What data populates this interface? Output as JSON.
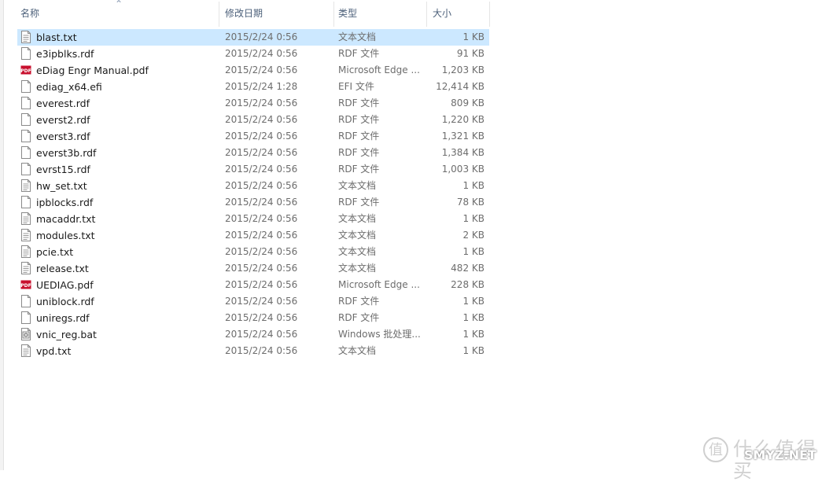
{
  "columns": {
    "name": "名称",
    "modified": "修改日期",
    "type": "类型",
    "size": "大小"
  },
  "files": [
    {
      "name": "blast.txt",
      "date": "2015/2/24 0:56",
      "type": "文本文档",
      "size": "1 KB",
      "icon": "text-file-icon"
    },
    {
      "name": "e3ipblks.rdf",
      "date": "2015/2/24 0:56",
      "type": "RDF 文件",
      "size": "91 KB",
      "icon": "generic-file-icon"
    },
    {
      "name": "eDiag Engr Manual.pdf",
      "date": "2015/2/24 0:56",
      "type": "Microsoft Edge ...",
      "size": "1,203 KB",
      "icon": "pdf-file-icon"
    },
    {
      "name": "ediag_x64.efi",
      "date": "2015/2/24 1:28",
      "type": "EFI 文件",
      "size": "12,414 KB",
      "icon": "generic-file-icon"
    },
    {
      "name": "everest.rdf",
      "date": "2015/2/24 0:56",
      "type": "RDF 文件",
      "size": "809 KB",
      "icon": "generic-file-icon"
    },
    {
      "name": "everst2.rdf",
      "date": "2015/2/24 0:56",
      "type": "RDF 文件",
      "size": "1,220 KB",
      "icon": "generic-file-icon"
    },
    {
      "name": "everst3.rdf",
      "date": "2015/2/24 0:56",
      "type": "RDF 文件",
      "size": "1,321 KB",
      "icon": "generic-file-icon"
    },
    {
      "name": "everst3b.rdf",
      "date": "2015/2/24 0:56",
      "type": "RDF 文件",
      "size": "1,384 KB",
      "icon": "generic-file-icon"
    },
    {
      "name": "evrst15.rdf",
      "date": "2015/2/24 0:56",
      "type": "RDF 文件",
      "size": "1,003 KB",
      "icon": "generic-file-icon"
    },
    {
      "name": "hw_set.txt",
      "date": "2015/2/24 0:56",
      "type": "文本文档",
      "size": "1 KB",
      "icon": "text-file-icon"
    },
    {
      "name": "ipblocks.rdf",
      "date": "2015/2/24 0:56",
      "type": "RDF 文件",
      "size": "78 KB",
      "icon": "generic-file-icon"
    },
    {
      "name": "macaddr.txt",
      "date": "2015/2/24 0:56",
      "type": "文本文档",
      "size": "1 KB",
      "icon": "text-file-icon"
    },
    {
      "name": "modules.txt",
      "date": "2015/2/24 0:56",
      "type": "文本文档",
      "size": "2 KB",
      "icon": "text-file-icon"
    },
    {
      "name": "pcie.txt",
      "date": "2015/2/24 0:56",
      "type": "文本文档",
      "size": "1 KB",
      "icon": "text-file-icon"
    },
    {
      "name": "release.txt",
      "date": "2015/2/24 0:56",
      "type": "文本文档",
      "size": "482 KB",
      "icon": "text-file-icon"
    },
    {
      "name": "UEDIAG.pdf",
      "date": "2015/2/24 0:56",
      "type": "Microsoft Edge ...",
      "size": "228 KB",
      "icon": "pdf-file-icon"
    },
    {
      "name": "uniblock.rdf",
      "date": "2015/2/24 0:56",
      "type": "RDF 文件",
      "size": "1 KB",
      "icon": "generic-file-icon"
    },
    {
      "name": "uniregs.rdf",
      "date": "2015/2/24 0:56",
      "type": "RDF 文件",
      "size": "1 KB",
      "icon": "generic-file-icon"
    },
    {
      "name": "vnic_reg.bat",
      "date": "2015/2/24 0:56",
      "type": "Windows 批处理...",
      "size": "1 KB",
      "icon": "batch-file-icon"
    },
    {
      "name": "vpd.txt",
      "date": "2015/2/24 0:56",
      "type": "文本文档",
      "size": "1 KB",
      "icon": "text-file-icon"
    }
  ],
  "selected_index": 0,
  "pdf_icon_label": "PDF",
  "watermark": {
    "logo_char": "值",
    "cn": "什么值得买",
    "en": "SMYZ.NET"
  },
  "colors": {
    "selection": "#cce8ff",
    "header_text": "#4c607a",
    "pdf_red": "#c8102e"
  }
}
